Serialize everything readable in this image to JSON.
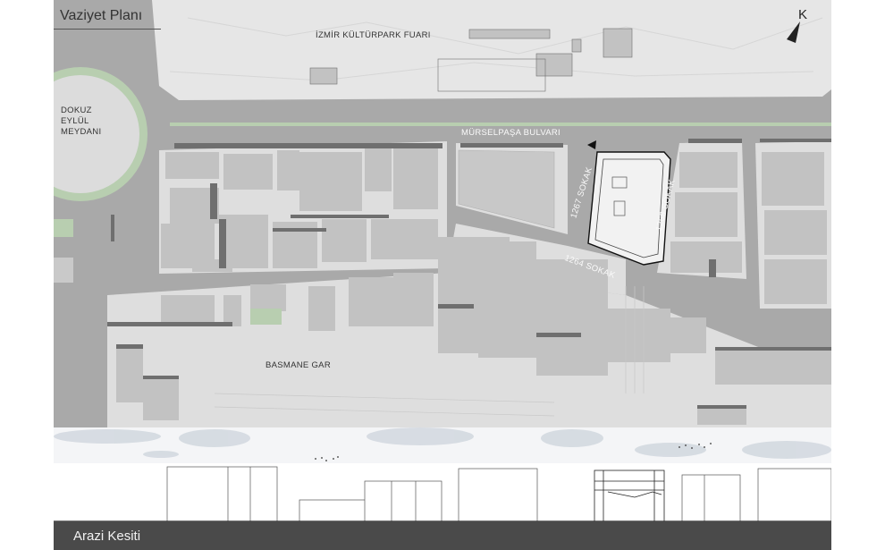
{
  "plan": {
    "title": "Vaziyet Planı",
    "north_letter": "K",
    "north_icon": "north-arrow-icon",
    "labels": {
      "fair": "İZMİR KÜLTÜRPARK FUARI",
      "square_line1": "DOKUZ",
      "square_line2": "EYLÜL",
      "square_line3": "MEYDANI",
      "boulevard": "MÜRSELPAŞA BULVARI",
      "street_1267": "1267 SOKAK",
      "street_1268": "1268 SOKAK",
      "street_1264": "1264 SOKAK",
      "station": "BASMANE GAR"
    }
  },
  "section": {
    "title": "Arazi Kesiti"
  },
  "colors": {
    "road": "#a9a9a9",
    "block": "#dedede",
    "building": "#c2c2c2",
    "building_shadow": "#6f6f6f",
    "park": "#e6e6e6",
    "green": "#b8ceb0",
    "site_outline": "#111111"
  }
}
